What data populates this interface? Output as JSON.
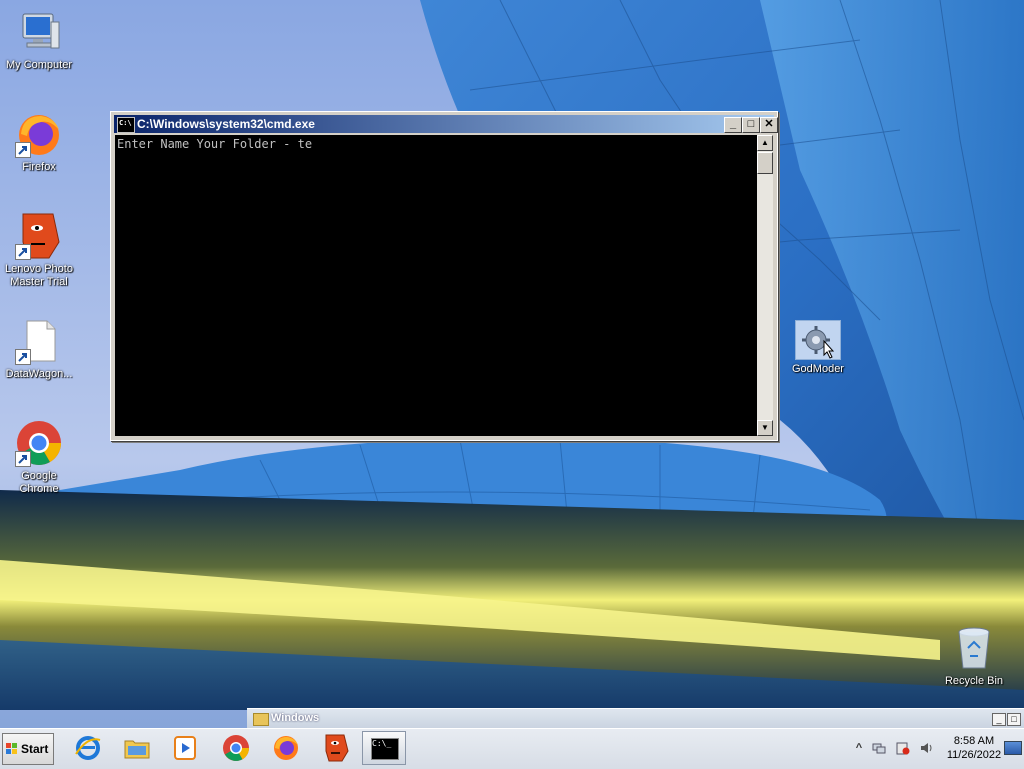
{
  "desktop": {
    "icons": [
      {
        "label": "My Computer"
      },
      {
        "label": "Firefox"
      },
      {
        "label": "Lenovo Photo Master Trial"
      },
      {
        "label": "DataWagon..."
      },
      {
        "label": "Google Chrome"
      },
      {
        "label": "GodModer"
      },
      {
        "label": "Recycle Bin"
      }
    ]
  },
  "cmd_window": {
    "title": "C:\\Windows\\system32\\cmd.exe",
    "icon_text": "C:\\",
    "output": "Enter Name Your Folder - te",
    "buttons": {
      "minimize": "_",
      "maximize": "□",
      "close": "✕"
    },
    "scroll_up": "▲",
    "scroll_down": "▼"
  },
  "background_window": {
    "title": "Windows"
  },
  "taskbar": {
    "start_label": "Start",
    "items": [
      {
        "name": "internet-explorer"
      },
      {
        "name": "windows-explorer"
      },
      {
        "name": "media-player"
      },
      {
        "name": "google-chrome"
      },
      {
        "name": "firefox"
      },
      {
        "name": "lenovo-photo-master"
      },
      {
        "name": "command-prompt",
        "icon_text": "C:\\_",
        "active": true
      }
    ],
    "tray": {
      "expand": "^",
      "time": "8:58 AM",
      "date": "11/26/2022"
    }
  },
  "colors": {
    "title_bar_start": "#0a246a",
    "title_bar_end": "#a6caf0",
    "console_bg": "#000000",
    "console_fg": "#c0c0c0"
  }
}
